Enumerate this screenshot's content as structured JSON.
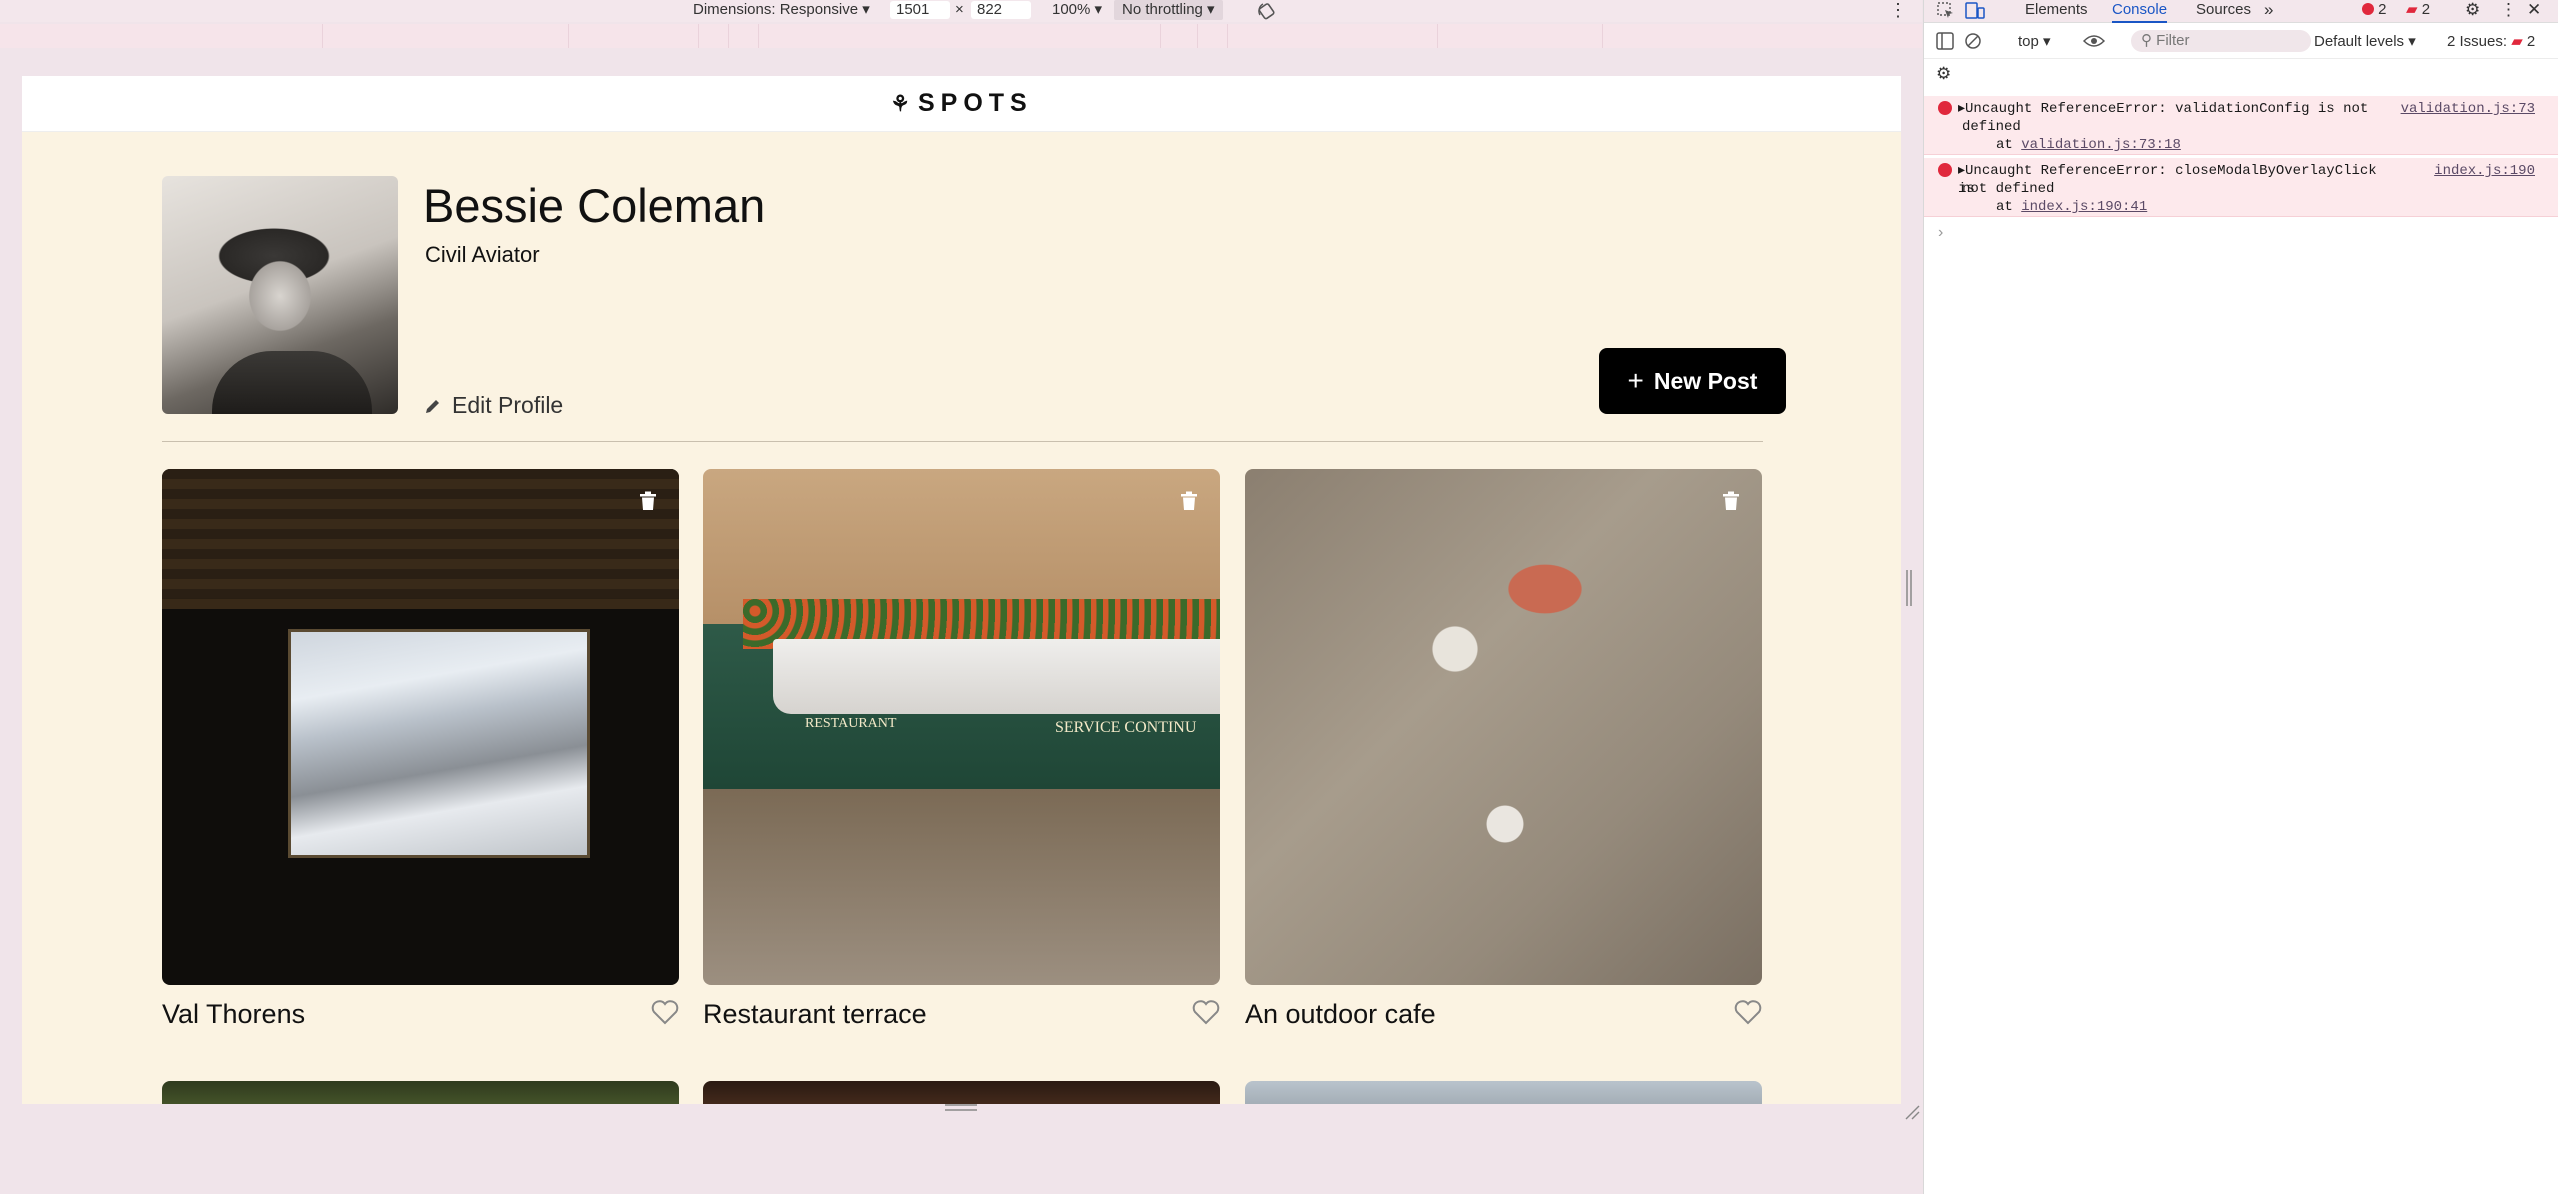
{
  "device_toolbar": {
    "dimensions_label": "Dimensions: Responsive",
    "width_value": "1501",
    "times_sign": "×",
    "height_value": "822",
    "zoom_label": "100%",
    "throttle_label": "No throttling"
  },
  "site": {
    "logo_text": "SPOTS",
    "logo_mark": "⚘",
    "profile": {
      "name": "Bessie Coleman",
      "description": "Civil Aviator",
      "edit_label": "Edit Profile",
      "new_post_label": "New Post"
    },
    "cards": [
      {
        "title": "Val Thorens"
      },
      {
        "title": "Restaurant terrace",
        "sign_left": "RESTAURANT",
        "sign_right": "SERVICE CONTINU"
      },
      {
        "title": "An outdoor cafe"
      }
    ]
  },
  "devtools": {
    "tabs": [
      "Elements",
      "Console",
      "Sources"
    ],
    "active_tab": "Console",
    "error_count": "2",
    "warning_count": "2",
    "context": "top",
    "filter_placeholder": "Filter",
    "levels_label": "Default levels",
    "issues_label": "2 Issues:",
    "issues_count": "2",
    "messages": [
      {
        "text_line1": "Uncaught ReferenceError: validationConfig is not",
        "text_line2": "defined",
        "location": "validation.js:73",
        "stack": "at",
        "stack_link": "validation.js:73:18"
      },
      {
        "text_line1": "Uncaught ReferenceError: closeModalByOverlayClick is",
        "text_line2": "not defined",
        "location": "index.js:190",
        "stack": "at",
        "stack_link": "index.js:190:41"
      }
    ],
    "prompt_symbol": "›"
  },
  "colors": {
    "page_bg": "#fbf3e2",
    "button_bg": "#000000",
    "error_red": "#e0283c",
    "devtools_accent": "#1a56c5"
  }
}
